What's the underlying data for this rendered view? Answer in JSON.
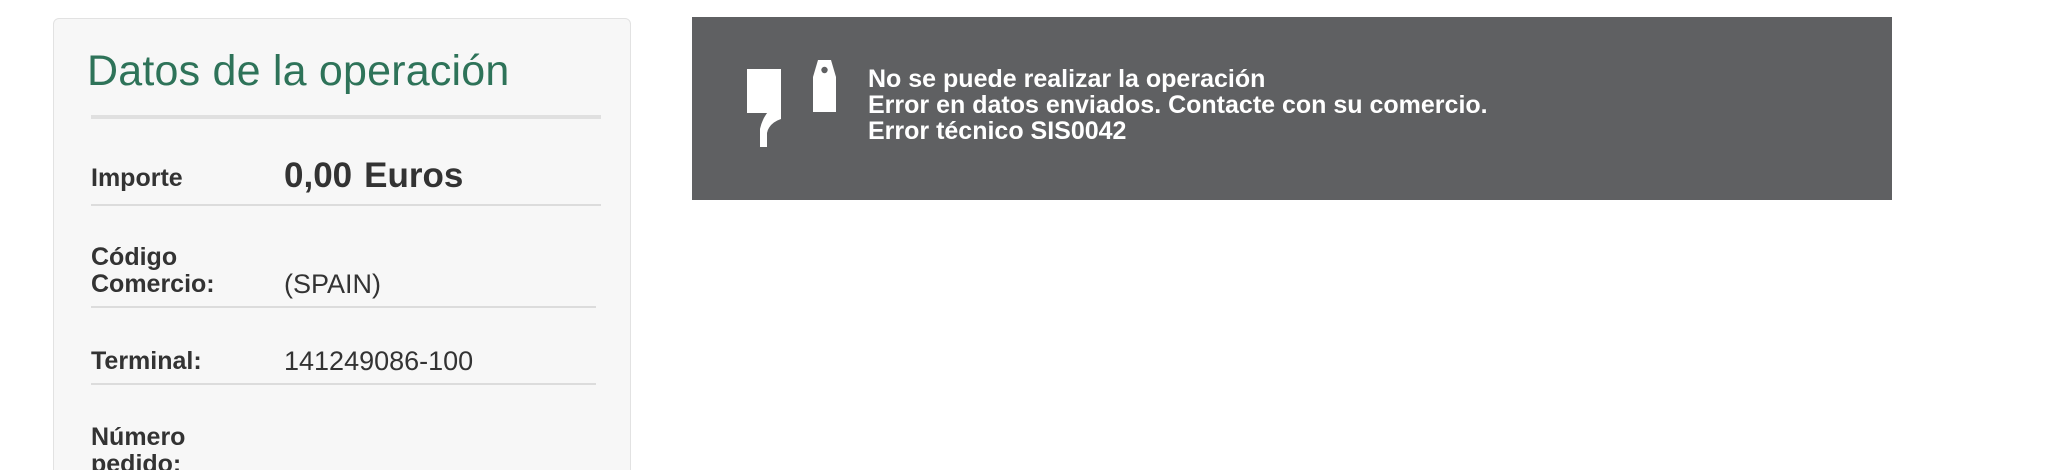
{
  "operation_panel": {
    "title": "Datos de la operación",
    "amount": {
      "label": "Importe",
      "value": "0,00",
      "currency": "Euros"
    },
    "merchant_code": {
      "label": "Código Comercio:",
      "value": "(SPAIN)"
    },
    "terminal": {
      "label": "Terminal:",
      "value": "141249086-100"
    },
    "order_number": {
      "label": "Número pedido:",
      "value": ""
    }
  },
  "error": {
    "icon": "thumbs-down-icon",
    "line1": "No se puede realizar la operación",
    "line2": "Error en datos enviados. Contacte con su comercio.",
    "line3": "Error técnico SIS0042"
  },
  "colors": {
    "title_green": "#2e7359",
    "error_bg": "#5f6062",
    "panel_bg": "#f7f7f7"
  }
}
